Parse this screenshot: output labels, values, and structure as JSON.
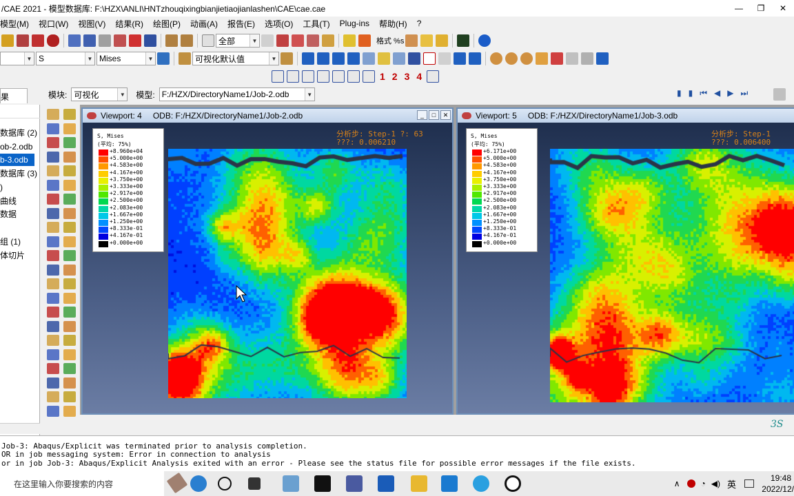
{
  "window": {
    "title": "/CAE 2021 - 模型数据库: F:\\HZX\\ANLI\\HNTzhouqixingbianjietiaojianlashen\\CAE\\cae.cae",
    "controls": [
      "—",
      "❐",
      "✕"
    ]
  },
  "menu": {
    "items": [
      "模型(M)",
      "视口(W)",
      "视图(V)",
      "结果(R)",
      "绘图(P)",
      "动画(A)",
      "报告(E)",
      "选项(O)",
      "工具(T)",
      "Plug-ins",
      "帮助(H)",
      "?"
    ]
  },
  "toolbar": {
    "selection_combo": "全部",
    "format_label": "格式 %s",
    "field_combo_1": "S",
    "field_combo_2": "Mises",
    "default_combo": "可视化默认值",
    "view_numbers": [
      "1",
      "2",
      "3",
      "4"
    ]
  },
  "context": {
    "module_label": "模块:",
    "module_value": "可视化",
    "model_label": "模型:",
    "model_value": "F:/HZX/DirectoryName1/Job-2.odb"
  },
  "tree": {
    "tab_label": "果",
    "items": [
      {
        "label": "数据库 (2)",
        "selected": false
      },
      {
        "label": "ob-2.odb",
        "selected": false
      },
      {
        "label": "b-3.odb",
        "selected": true
      },
      {
        "label": "数据库 (3)",
        "selected": false
      },
      {
        "label": ")",
        "selected": false
      },
      {
        "label": "曲线",
        "selected": false
      },
      {
        "label": "数据",
        "selected": false
      },
      {
        "label": "组 (1)",
        "selected": false
      },
      {
        "label": "体切片",
        "selected": false
      }
    ]
  },
  "viewports": [
    {
      "name": "Viewport: 4",
      "odb": "ODB: F:/HZX/DirectoryName1/Job-2.odb",
      "step_line": "分析步: Step-1   ?: 63",
      "time_line": "???: 0.006210",
      "legend_title": "S, Mises",
      "legend_avg": "(平均: 75%)",
      "legend_values": [
        "+8.960e+04",
        "+5.000e+00",
        "+4.583e+00",
        "+4.167e+00",
        "+3.750e+00",
        "+3.333e+00",
        "+2.917e+00",
        "+2.500e+00",
        "+2.083e+00",
        "+1.667e+00",
        "+1.250e+00",
        "+8.333e-01",
        "+4.167e-01",
        "+0.000e+00"
      ]
    },
    {
      "name": "Viewport: 5",
      "odb": "ODB: F:/HZX/DirectoryName1/Job-3.odb",
      "step_line": "分析步: Step-1",
      "time_line": "???: 0.006400",
      "legend_title": "S, Mises",
      "legend_avg": "(平均: 75%)",
      "legend_values": [
        "+6.171e+00",
        "+5.000e+00",
        "+4.583e+00",
        "+4.167e+00",
        "+3.750e+00",
        "+3.333e+00",
        "+2.917e+00",
        "+2.500e+00",
        "+2.083e+00",
        "+1.667e+00",
        "+1.250e+00",
        "+8.333e-01",
        "+4.167e-01",
        "+0.000e+00"
      ]
    }
  ],
  "legend_colors": [
    "#ff0000",
    "#ff5000",
    "#ff9900",
    "#ffcc00",
    "#e8f000",
    "#a8f000",
    "#50e800",
    "#00d850",
    "#00d8a8",
    "#00c8e8",
    "#0090ff",
    "#0048ff",
    "#0000e0",
    "#000000"
  ],
  "messages": [
    " Job-3: Abaqus/Explicit was terminated prior to analysis completion.",
    "OR in job messaging system: Error in connection to analysis",
    "or in job Job-3: Abaqus/Explicit Analysis exited with an error - Please see the  status file for possible error messages if the file exists."
  ],
  "taskbar": {
    "search_placeholder": "在这里输入你要搜索的内容",
    "ime": "英",
    "time": "19:48",
    "date": "2022/12/"
  },
  "brand": "3S"
}
